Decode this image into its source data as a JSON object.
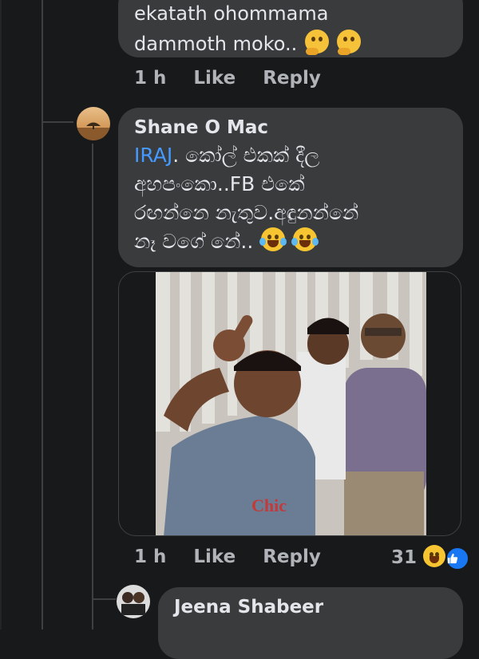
{
  "comment1": {
    "text_line1": "ekatath ohommama",
    "text_line2": "dammoth moko..",
    "emoji": [
      "thinking-face",
      "thinking-face"
    ],
    "time": "1 h",
    "like": "Like",
    "reply": "Reply"
  },
  "comment2": {
    "author": "Shane O Mac",
    "mention": "IRAJ",
    "text_line1": ". කෝල් එකක් දීල",
    "text_line2": "අහපංකො..FB එකේ",
    "text_line3": "රඟන්නෙ නැතුව.අඳුනන්නේ",
    "text_line4": "නෑ වගේ නේ..",
    "emoji": [
      "face-with-tears-of-joy",
      "face-with-tears-of-joy"
    ],
    "time": "1 h",
    "like": "Like",
    "reply": "Reply",
    "reaction_count": "31",
    "reactions": [
      "laughing-face",
      "like-thumb"
    ]
  },
  "comment3": {
    "author": "Jeena Shabeer"
  },
  "colors": {
    "background": "#18191a",
    "bubble": "#3a3b3c",
    "mention": "#4599ff",
    "meta": "#b0b3b8"
  }
}
